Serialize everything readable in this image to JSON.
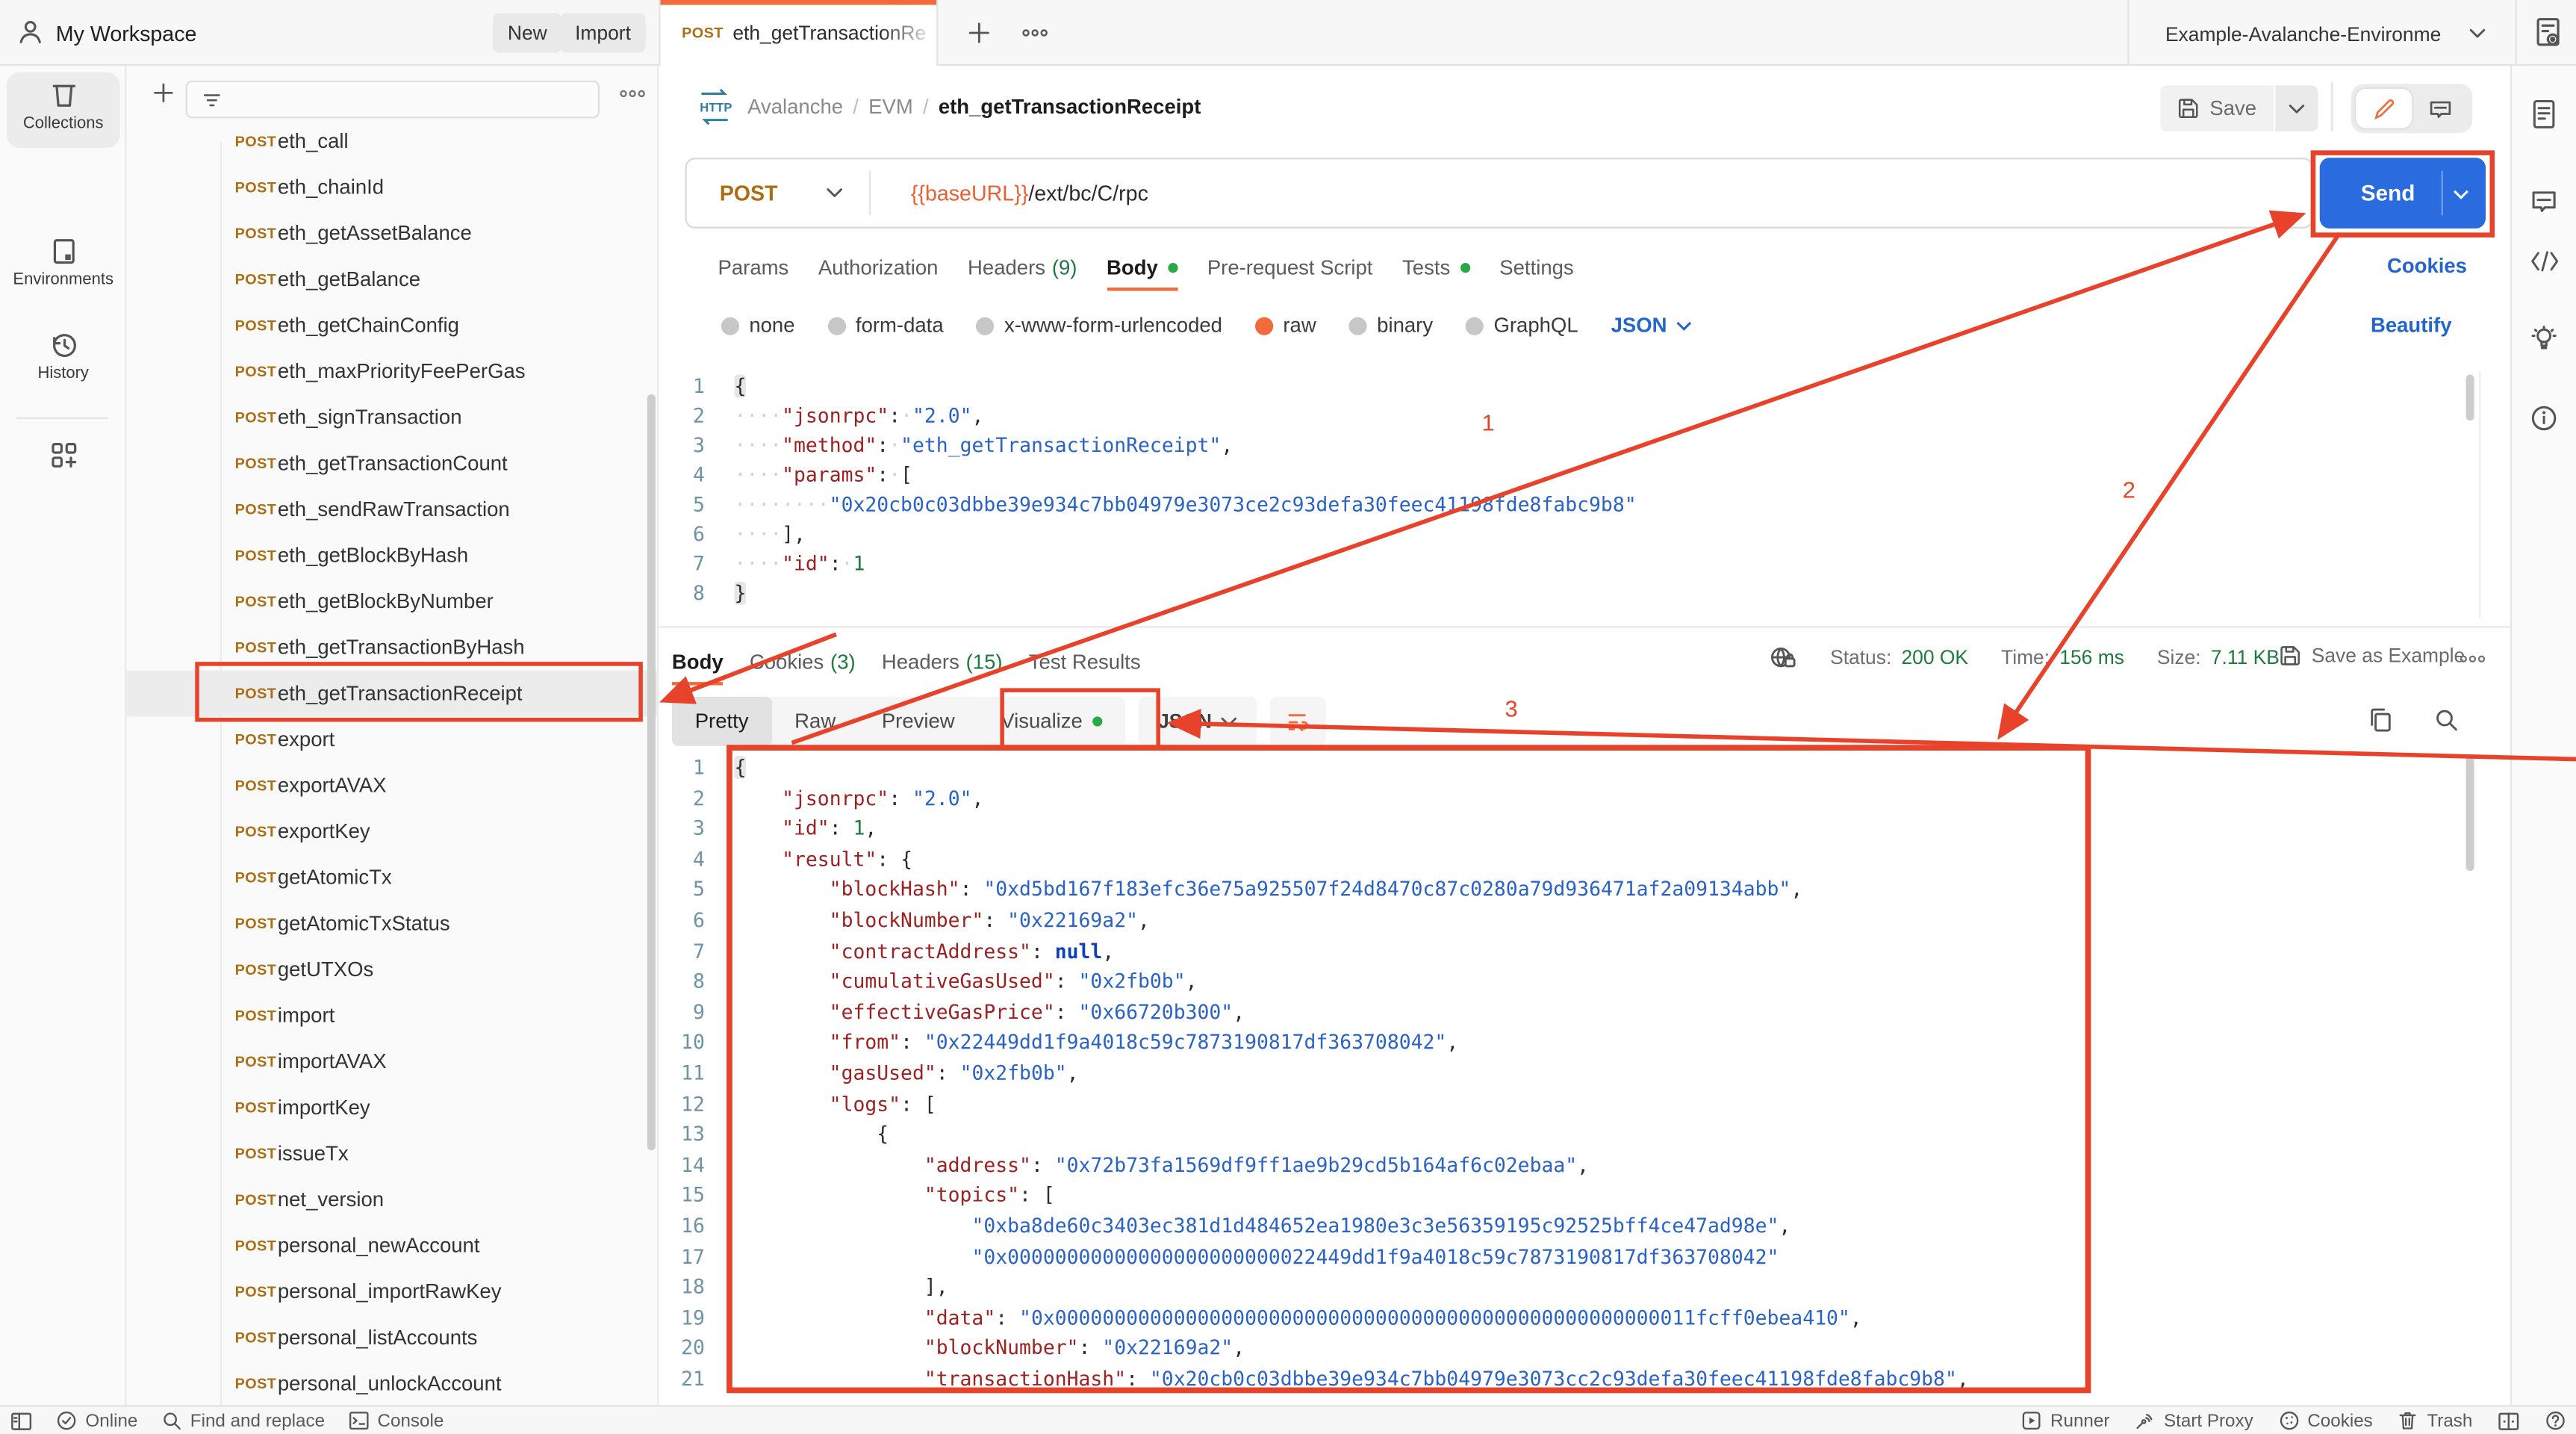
{
  "header": {
    "workspace_label": "My Workspace",
    "new_button": "New",
    "import_button": "Import",
    "active_tab": {
      "method": "POST",
      "title": "eth_getTransactionRece"
    },
    "environment_selector": "Example-Avalanche-Environme"
  },
  "nav_rail": {
    "items": [
      {
        "label": "Collections"
      },
      {
        "label": "Environments"
      },
      {
        "label": "History"
      }
    ]
  },
  "sidebar": {
    "method_badge": "POST",
    "active_request": "eth_getTransactionReceipt",
    "requests": [
      "eth_call",
      "eth_chainId",
      "eth_getAssetBalance",
      "eth_getBalance",
      "eth_getChainConfig",
      "eth_maxPriorityFeePerGas",
      "eth_signTransaction",
      "eth_getTransactionCount",
      "eth_sendRawTransaction",
      "eth_getBlockByHash",
      "eth_getBlockByNumber",
      "eth_getTransactionByHash",
      "eth_getTransactionReceipt",
      "export",
      "exportAVAX",
      "exportKey",
      "getAtomicTx",
      "getAtomicTxStatus",
      "getUTXOs",
      "import",
      "importAVAX",
      "importKey",
      "issueTx",
      "net_version",
      "personal_newAccount",
      "personal_importRawKey",
      "personal_listAccounts",
      "personal_unlockAccount"
    ]
  },
  "request": {
    "breadcrumb": {
      "collection": "Avalanche",
      "folder": "EVM",
      "name": "eth_getTransactionReceipt",
      "separator": "/"
    },
    "save_button": "Save",
    "method": "POST",
    "url_variable": "{{baseURL}}",
    "url_path": "/ext/bc/C/rpc",
    "send_button": "Send",
    "tabs": [
      {
        "label": "Params"
      },
      {
        "label": "Authorization"
      },
      {
        "label": "Headers",
        "count": "(9)"
      },
      {
        "label": "Body",
        "dot": true,
        "active": true
      },
      {
        "label": "Pre-request Script"
      },
      {
        "label": "Tests",
        "dot": true
      },
      {
        "label": "Settings"
      }
    ],
    "cookies_link": "Cookies",
    "beautify_link": "Beautify",
    "body_modes": [
      {
        "label": "none"
      },
      {
        "label": "form-data"
      },
      {
        "label": "x-www-form-urlencoded"
      },
      {
        "label": "raw",
        "selected": true
      },
      {
        "label": "binary"
      },
      {
        "label": "GraphQL"
      }
    ],
    "language_selector": "JSON",
    "code_lines": [
      "{",
      "    \"jsonrpc\": \"2.0\",",
      "    \"method\": \"eth_getTransactionReceipt\",",
      "    \"params\": [",
      "        \"0x20cb0c03dbbe39e934c7bb04979e3073ce2c93defa30feec41198fde8fabc9b8\"",
      "    ],",
      "    \"id\": 1",
      "}"
    ]
  },
  "response": {
    "tabs": [
      {
        "label": "Body",
        "active": true
      },
      {
        "label": "Cookies",
        "count": "(3)"
      },
      {
        "label": "Headers",
        "count": "(15)"
      },
      {
        "label": "Test Results"
      }
    ],
    "meta": {
      "status_label": "Status:",
      "status_value": "200 OK",
      "time_label": "Time:",
      "time_value": "156 ms",
      "size_label": "Size:",
      "size_value": "7.11 KB",
      "save_as_example": "Save as Example"
    },
    "view_tabs": [
      {
        "label": "Pretty",
        "active": true
      },
      {
        "label": "Raw"
      },
      {
        "label": "Preview"
      },
      {
        "label": "Visualize",
        "dot": true
      }
    ],
    "format_selector": "JSON",
    "code_lines": [
      "{",
      "    \"jsonrpc\": \"2.0\",",
      "    \"id\": 1,",
      "    \"result\": {",
      "        \"blockHash\": \"0xd5bd167f183efc36e75a925507f24d8470c87c0280a79d936471af2a09134abb\",",
      "        \"blockNumber\": \"0x22169a2\",",
      "        \"contractAddress\": null,",
      "        \"cumulativeGasUsed\": \"0x2fb0b\",",
      "        \"effectiveGasPrice\": \"0x66720b300\",",
      "        \"from\": \"0x22449dd1f9a4018c59c7873190817df363708042\",",
      "        \"gasUsed\": \"0x2fb0b\",",
      "        \"logs\": [",
      "            {",
      "                \"address\": \"0x72b73fa1569df9ff1ae9b29cd5b164af6c02ebaa\",",
      "                \"topics\": [",
      "                    \"0xba8de60c3403ec381d1d484652ea1980e3c3e56359195c92525bff4ce47ad98e\",",
      "                    \"0x00000000000000000000000022449dd1f9a4018c59c7873190817df363708042\"",
      "                ],",
      "                \"data\": \"0x000000000000000000000000000000000000000000000000000011fcff0ebea410\",",
      "                \"blockNumber\": \"0x22169a2\",",
      "                \"transactionHash\": \"0x20cb0c03dbbe39e934c7bb04979e3073cc2c93defa30feec41198fde8fabc9b8\","
    ]
  },
  "footer": {
    "online_label": "Online",
    "find_label": "Find and replace",
    "console_label": "Console",
    "runner_label": "Runner",
    "proxy_label": "Start Proxy",
    "cookies_label": "Cookies",
    "trash_label": "Trash"
  },
  "annotations": {
    "labels": [
      "1",
      "2",
      "3"
    ]
  },
  "colors": {
    "accent_orange": "#f26b3a",
    "send_blue": "#2b6be0",
    "annotation_red": "#e8432a",
    "method_amber": "#ab6e13",
    "link_blue": "#2464cd",
    "status_green": "#1f7a3d"
  }
}
